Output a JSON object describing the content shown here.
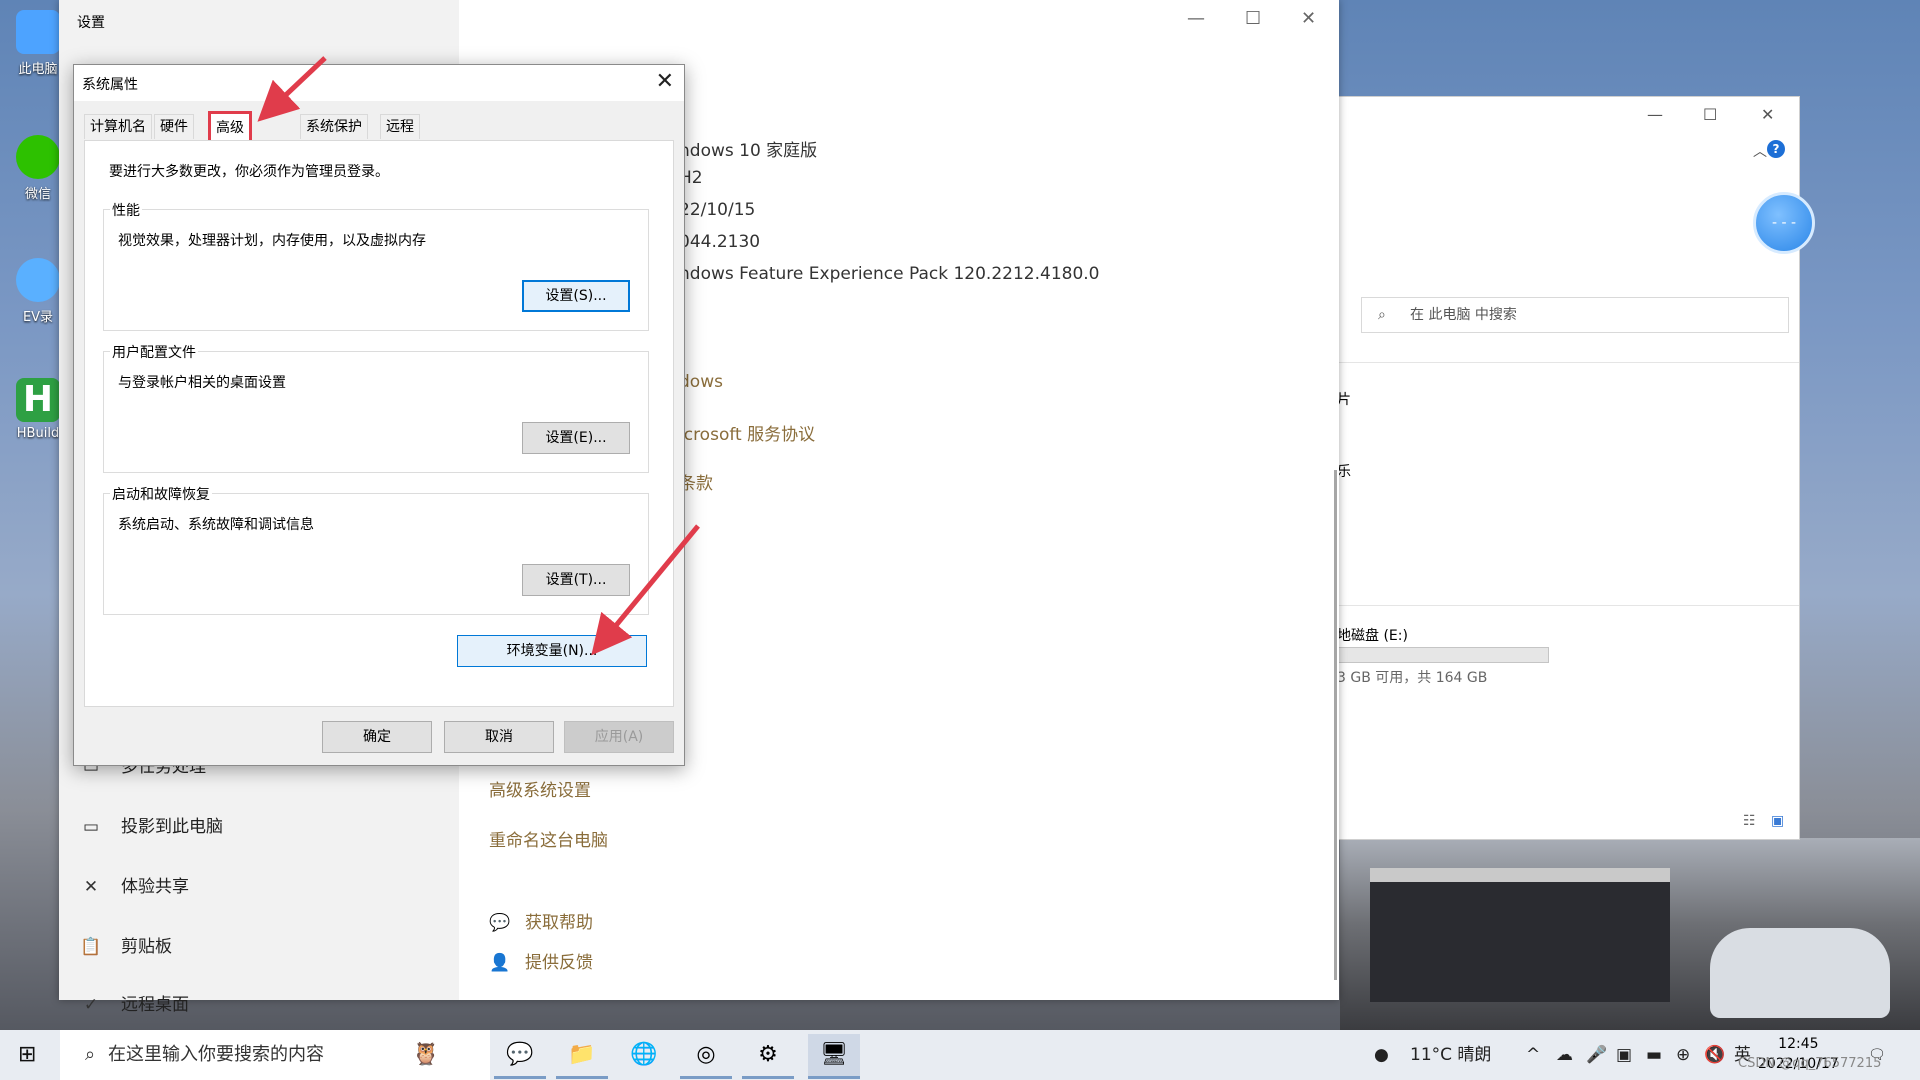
{
  "desktop": {
    "icons": [
      {
        "label": "此电脑",
        "color": "#4da3ff"
      },
      {
        "label": "微信",
        "color": "#2dc100"
      },
      {
        "label": "EV录",
        "color": "#5ab0ff"
      },
      {
        "label": "HBuild",
        "color": "#2ea043"
      }
    ]
  },
  "explorer": {
    "search_placeholder": "在 此电脑 中搜索",
    "help_icon": "?",
    "trunc_text_1": "片",
    "trunc_text_2": "乐",
    "disk_label": "地磁盘 (E:)",
    "disk_info": "3 GB 可用，共 164 GB",
    "disk_fill_fraction": 0.0
  },
  "settings": {
    "title": "设置",
    "info": [
      "ndows 10 家庭版",
      "H2",
      "22/10/15",
      "044.2130",
      "ndows Feature Experience Pack 120.2212.4180.0"
    ],
    "links": [
      "dows",
      "icrosoft 服务协议",
      "条款"
    ],
    "related": [
      "高级系统设置",
      "重命名这台电脑"
    ],
    "help": [
      "获取帮助",
      "提供反馈"
    ],
    "nav": [
      {
        "label": "多任务处理",
        "icon": "multitask-icon"
      },
      {
        "label": "投影到此电脑",
        "icon": "project-icon"
      },
      {
        "label": "体验共享",
        "icon": "share-icon"
      },
      {
        "label": "剪贴板",
        "icon": "clipboard-icon"
      },
      {
        "label": "远程桌面",
        "icon": "remote-icon"
      }
    ]
  },
  "dialog": {
    "title": "系统属性",
    "tabs": [
      "计算机名",
      "硬件",
      "高级",
      "系统保护",
      "远程"
    ],
    "active_tab": "高级",
    "note": "要进行大多数更改，你必须作为管理员登录。",
    "groups": [
      {
        "title": "性能",
        "desc": "视觉效果，处理器计划，内存使用，以及虚拟内存",
        "button": "设置(S)..."
      },
      {
        "title": "用户配置文件",
        "desc": "与登录帐户相关的桌面设置",
        "button": "设置(E)..."
      },
      {
        "title": "启动和故障恢复",
        "desc": "系统启动、系统故障和调试信息",
        "button": "设置(T)..."
      }
    ],
    "env_button": "环境变量(N)...",
    "ok": "确定",
    "cancel": "取消",
    "apply": "应用(A)"
  },
  "taskbar": {
    "search_placeholder": "在这里输入你要搜索的内容",
    "weather": "11°C  晴朗",
    "ime": "英",
    "time": "12:45",
    "date": "2022/10/17",
    "watermark": "CSDN @qq_76577215"
  }
}
